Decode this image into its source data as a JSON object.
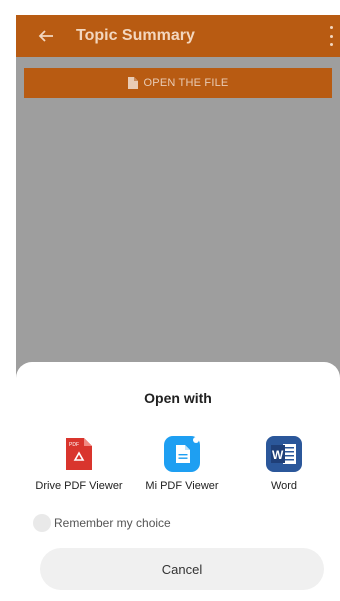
{
  "appbar": {
    "title": "Topic Summary"
  },
  "open_button": {
    "label": "OPEN THE FILE"
  },
  "sheet": {
    "title": "Open with",
    "apps": [
      {
        "label": "Drive PDF Viewer",
        "icon": "drive-pdf-icon"
      },
      {
        "label": "Mi PDF Viewer",
        "icon": "mi-pdf-icon"
      },
      {
        "label": "Word",
        "icon": "word-icon"
      }
    ],
    "remember_label": "Remember my choice",
    "cancel_label": "Cancel"
  },
  "colors": {
    "accent": "#b85b12",
    "scrim": "#9e9e9e",
    "pdf_red": "#d9352d",
    "mi_blue": "#1e9ff2",
    "word_blue": "#2b579a"
  }
}
